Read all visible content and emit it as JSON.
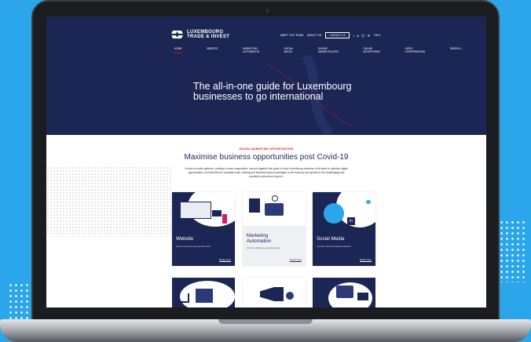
{
  "brand": {
    "line1": "LUXEMBOURG",
    "line2": "TRADE & INVEST"
  },
  "topnav": {
    "meet": "MEET THE TEAM",
    "about": "ABOUT US",
    "contact": "CONTACT US",
    "lang": "EN ▾"
  },
  "mainnav": {
    "home": "HOME",
    "items": [
      {
        "l1": "WEBSITE",
        "l2": ""
      },
      {
        "l1": "MARKETING",
        "l2": "AUTOMATION"
      },
      {
        "l1": "SOCIAL",
        "l2": "MEDIA"
      },
      {
        "l1": "ONLINE",
        "l2": "MARKETPLACES"
      },
      {
        "l1": "ONLINE",
        "l2": "ADVERTISING"
      },
      {
        "l1": "VIDEO",
        "l2": "CONFERENCING"
      }
    ],
    "search": "SEARCH"
  },
  "hero": {
    "title": "The all-in-one guide for Luxembourg businesses to go international"
  },
  "section": {
    "kicker": "DIGITAL MARKETING OPPORTUNITIES",
    "headline": "Maximise business opportunities post Covid-19",
    "intro": "A team of public partners, working in close cooperation, has put together this guide to help Luxembourg business of all sizes to optimise digital opportunities, and benefit from available tools, training and financial support packages to aid recovery and growth in the challenging post pandemic period and beyond."
  },
  "cards": [
    {
      "title": "Website",
      "title2": "",
      "desc": "Reach customers around the world",
      "link": "Read more"
    },
    {
      "title": "Marketing",
      "title2": "Automation",
      "desc": "Improve efficiency, generate leads",
      "link": "Read more"
    },
    {
      "title": "Social Media",
      "title2": "",
      "desc": "Connect with international followers",
      "link": "Read more"
    }
  ],
  "colors": {
    "navy": "#1c2654",
    "accent": "#e30613",
    "background": "#2ca6ea"
  }
}
